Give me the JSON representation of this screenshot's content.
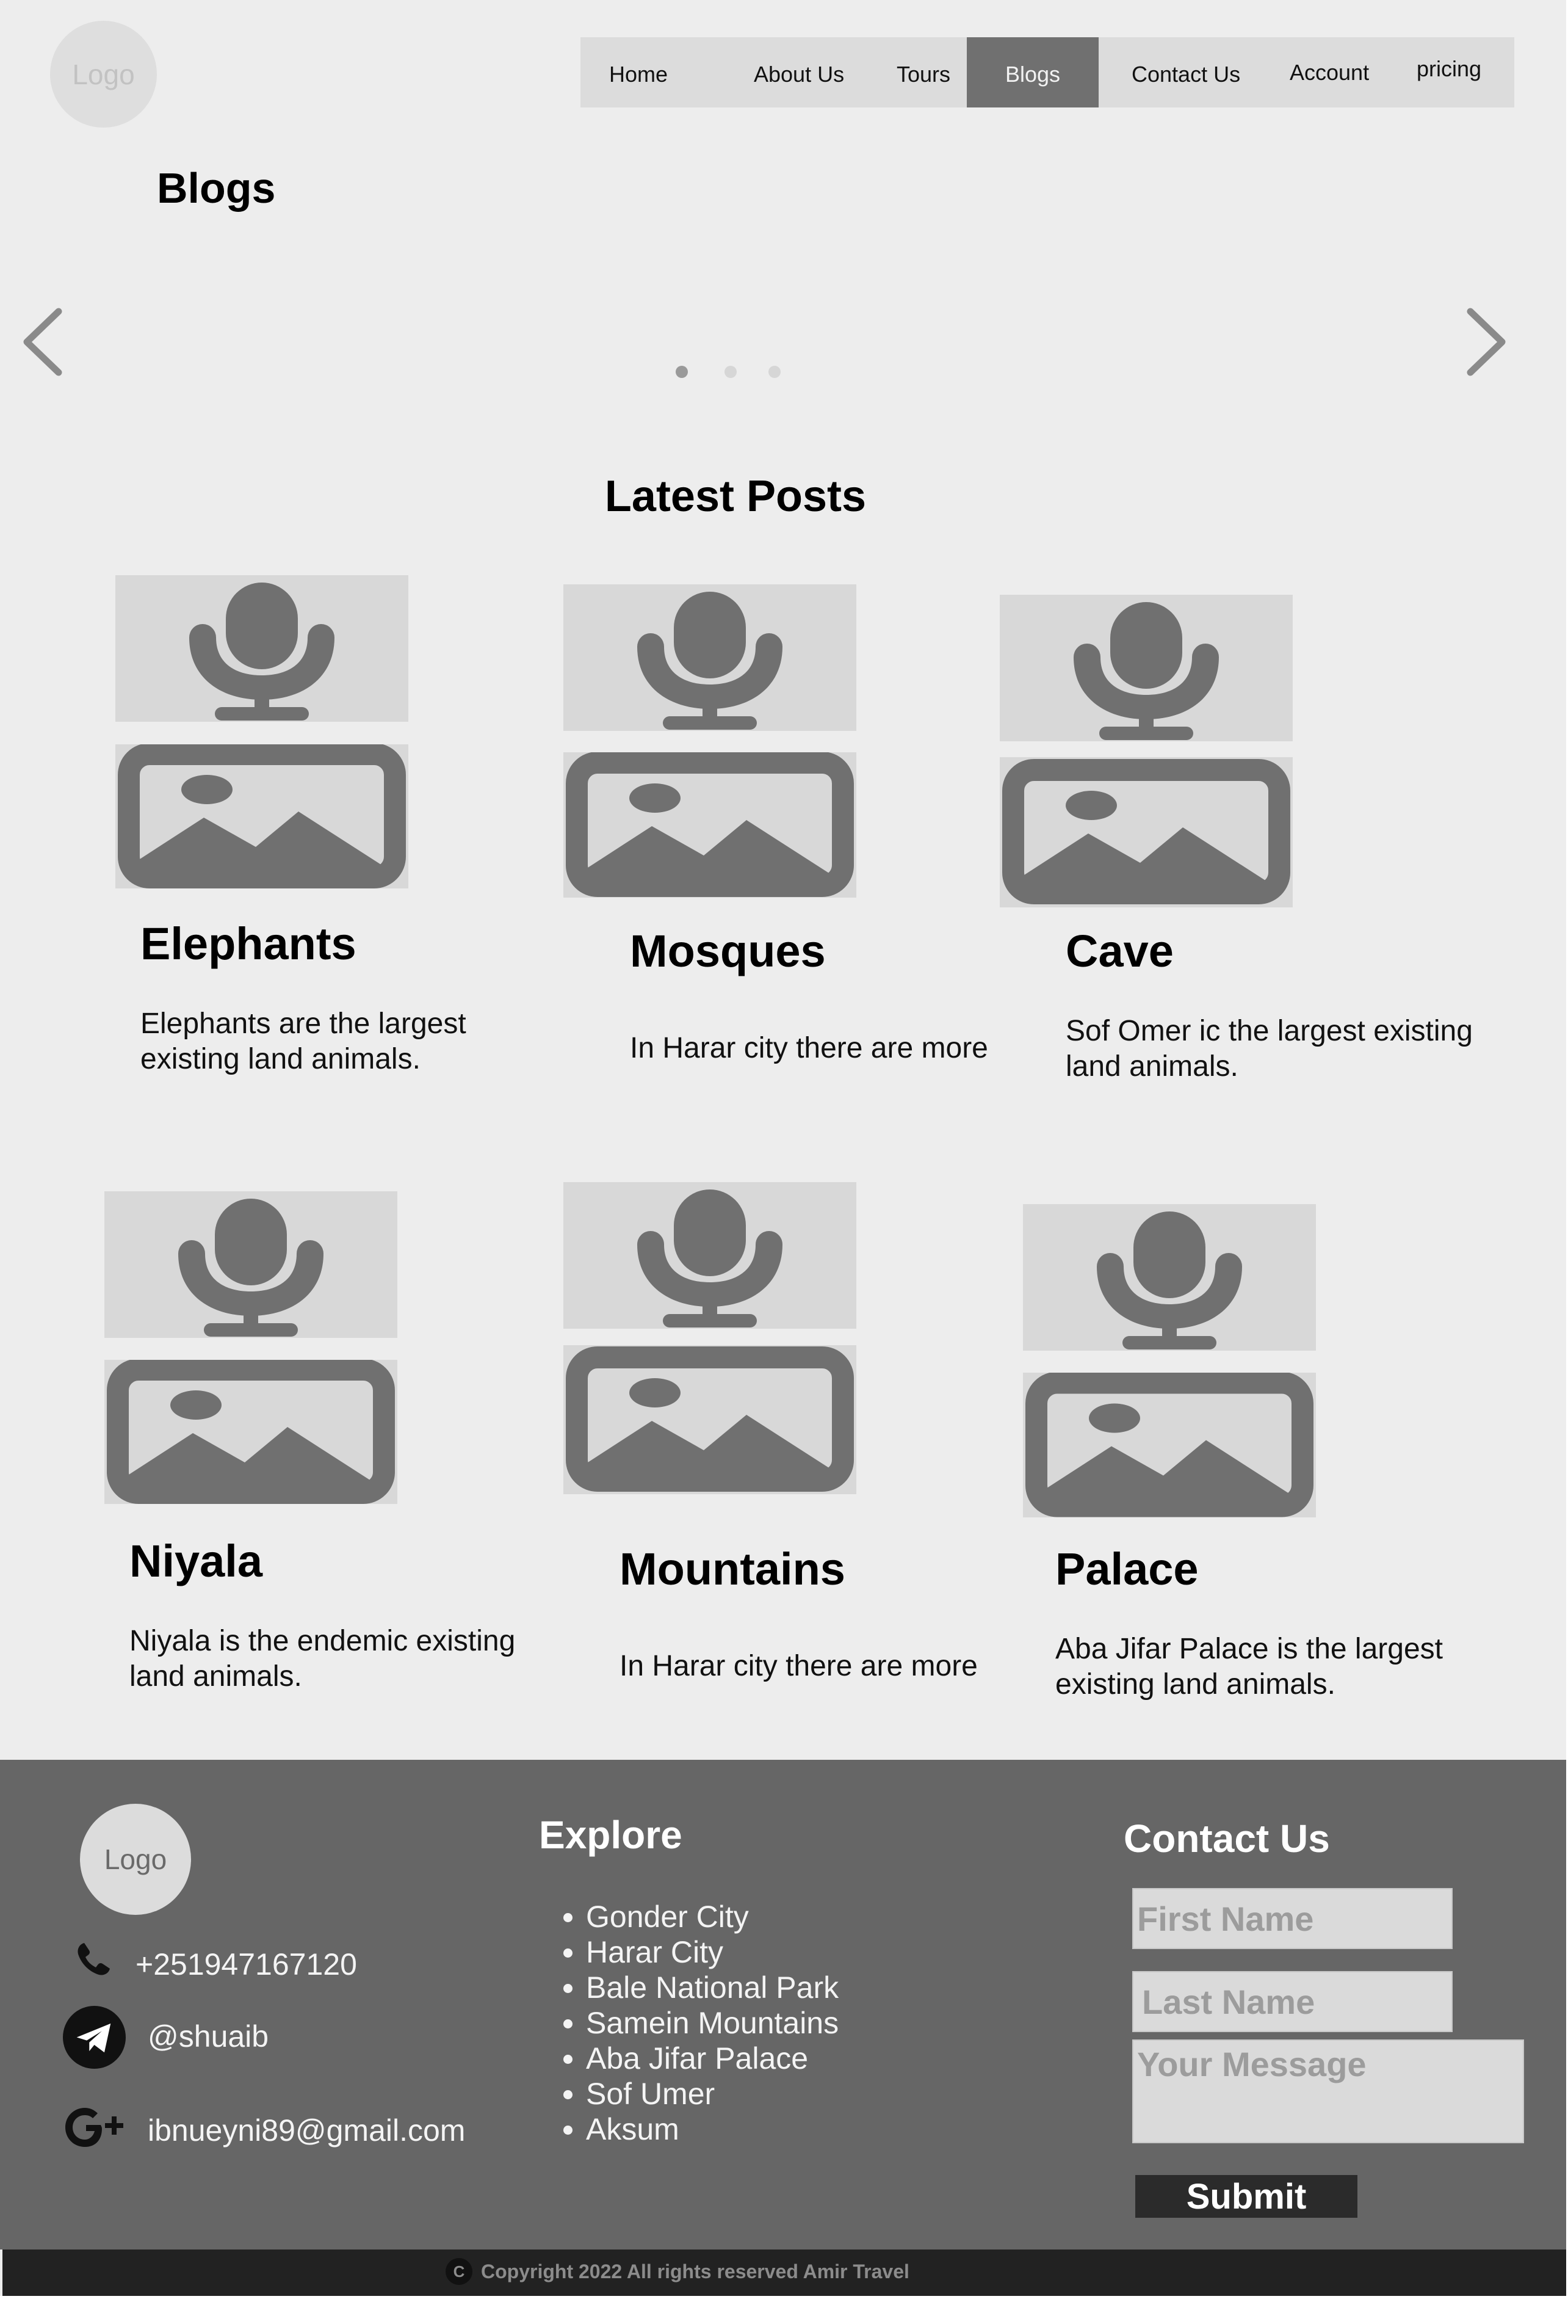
{
  "header": {
    "logo_label": "Logo",
    "nav": [
      "Home",
      "About Us",
      "Tours",
      "Blogs",
      "Contact Us",
      "Account",
      "pricing"
    ],
    "active_nav": "Blogs"
  },
  "hero": {
    "title": "Blogs",
    "carousel_dots": 3,
    "active_dot": 1
  },
  "latest": {
    "title": "Latest Posts",
    "posts": [
      {
        "title": "Elephants",
        "text": "Elephants are the largest existing land animals."
      },
      {
        "title": "Mosques",
        "text": "In Harar city there are more"
      },
      {
        "title": "Cave",
        "text": "Sof Omer ic the largest existing land animals."
      },
      {
        "title": "Niyala",
        "text": "Niyala is the endemic existing land animals."
      },
      {
        "title": "Mountains",
        "text": "In Harar city there are more"
      },
      {
        "title": "Palace",
        "text": "Aba Jifar Palace is the largest existing land animals."
      }
    ]
  },
  "footer": {
    "logo_label": "Logo",
    "phone": "+251947167120",
    "telegram": "@shuaib",
    "email": "ibnueyni89@gmail.com",
    "explore_title": "Explore",
    "explore_items": [
      "Gonder City",
      "Harar City",
      "Bale National Park",
      "Samein Mountains",
      "Aba Jifar Palace",
      "Sof Umer",
      "Aksum"
    ],
    "contact_title": "Contact Us",
    "form": {
      "first_name_placeholder": "First Name",
      "last_name_placeholder": "Last Name",
      "message_placeholder": "Your Message",
      "submit_label": "Submit"
    },
    "copyright_icon": "C",
    "copyright": "Copyright 2022 All rights reserved Amir Travel"
  },
  "colors": {
    "page_bg": "#ededed",
    "nav_bg": "#dcdcdc",
    "nav_active": "#707070",
    "footer_bg": "#666666",
    "copyright_bg": "#222222"
  }
}
